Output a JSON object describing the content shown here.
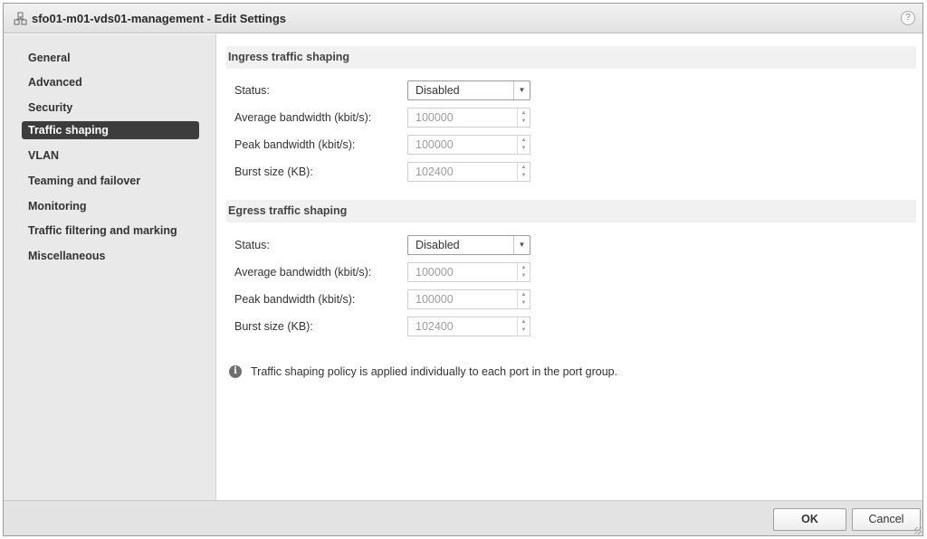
{
  "window": {
    "title": "sfo01-m01-vds01-management - Edit Settings",
    "help_label": "?"
  },
  "sidebar": {
    "items": [
      {
        "label": "General",
        "active": false
      },
      {
        "label": "Advanced",
        "active": false
      },
      {
        "label": "Security",
        "active": false
      },
      {
        "label": "Traffic shaping",
        "active": true
      },
      {
        "label": "VLAN",
        "active": false
      },
      {
        "label": "Teaming and failover",
        "active": false
      },
      {
        "label": "Monitoring",
        "active": false
      },
      {
        "label": "Traffic filtering and marking",
        "active": false
      },
      {
        "label": "Miscellaneous",
        "active": false
      }
    ]
  },
  "ingress": {
    "header": "Ingress traffic shaping",
    "status_label": "Status:",
    "status_value": "Disabled",
    "avg_label": "Average bandwidth (kbit/s):",
    "avg_value": "100000",
    "peak_label": "Peak bandwidth (kbit/s):",
    "peak_value": "100000",
    "burst_label": "Burst size (KB):",
    "burst_value": "102400"
  },
  "egress": {
    "header": "Egress traffic shaping",
    "status_label": "Status:",
    "status_value": "Disabled",
    "avg_label": "Average bandwidth (kbit/s):",
    "avg_value": "100000",
    "peak_label": "Peak bandwidth (kbit/s):",
    "peak_value": "100000",
    "burst_label": "Burst size (KB):",
    "burst_value": "102400"
  },
  "info": {
    "text": "Traffic shaping policy is applied individually to each port in the port group."
  },
  "footer": {
    "ok_label": "OK",
    "cancel_label": "Cancel"
  },
  "icons": {
    "title": "distributed-port-group-icon",
    "dropdown": "chevron-down-icon",
    "spinner": "spinner-arrows-icon",
    "info": "info-icon"
  }
}
